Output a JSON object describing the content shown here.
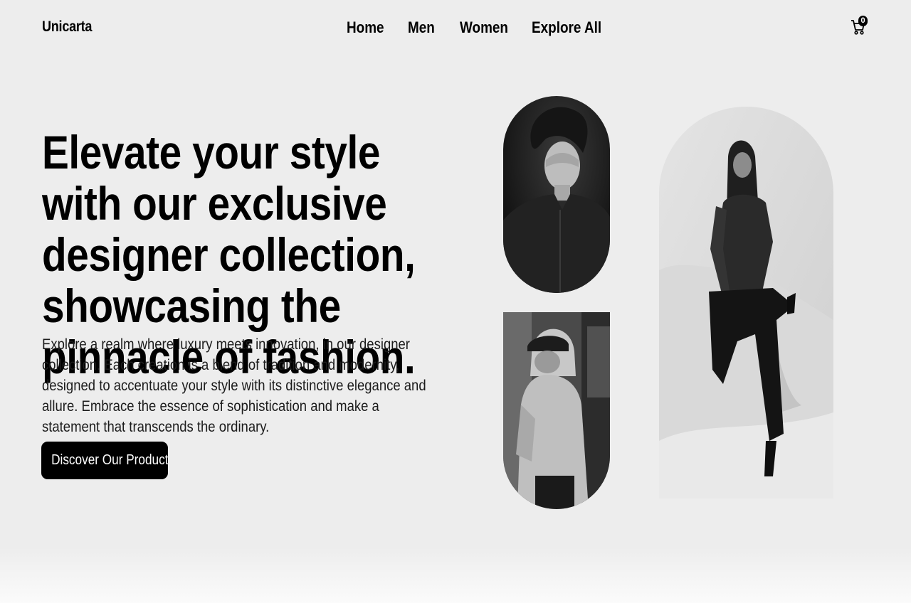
{
  "header": {
    "brand": "Unicarta",
    "nav": [
      {
        "label": "Home"
      },
      {
        "label": "Men"
      },
      {
        "label": "Women"
      },
      {
        "label": "Explore All"
      }
    ],
    "cart": {
      "icon": "cart-icon",
      "count": "0"
    }
  },
  "hero": {
    "headline": "Elevate your style with our exclusive designer collection, showcasing the pinnacle of fashion.",
    "description": "Explore a realm where luxury meets innovation, in our designer collection. Each creation is a blend of tradition and modernity, designed to accentuate your style with its distinctive elegance and allure. Embrace the essence of sophistication and make a statement that transcends the ordinary.",
    "cta_label": "Discover Our Products"
  },
  "colors": {
    "background": "#ededed",
    "text": "#000000",
    "button_bg": "#000000",
    "button_text": "#ffffff"
  }
}
